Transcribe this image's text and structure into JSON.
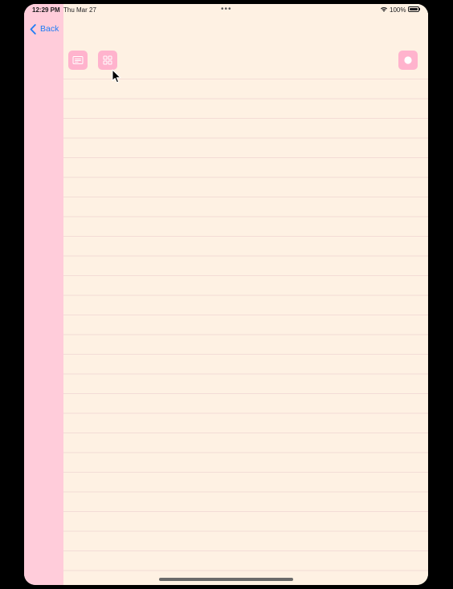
{
  "status_bar": {
    "time": "12:29 PM",
    "date": "Thu Mar 27",
    "multitask_dots": "•••",
    "battery_percent": "100%",
    "wifi_icon": "wifi-icon",
    "battery_icon": "battery-full-icon"
  },
  "nav": {
    "back_label": "Back",
    "back_icon": "chevron-left-icon"
  },
  "toolbar": {
    "list_view_icon": "list-view-icon",
    "grid_view_icon": "grid-view-icon",
    "record_icon": "record-icon"
  },
  "colors": {
    "paper": "#FEF1E3",
    "margin_strip": "#FFCCDA",
    "button": "#FFB3CD",
    "accent": "#1F7CF5",
    "rule_line": "#F3DCD6"
  }
}
